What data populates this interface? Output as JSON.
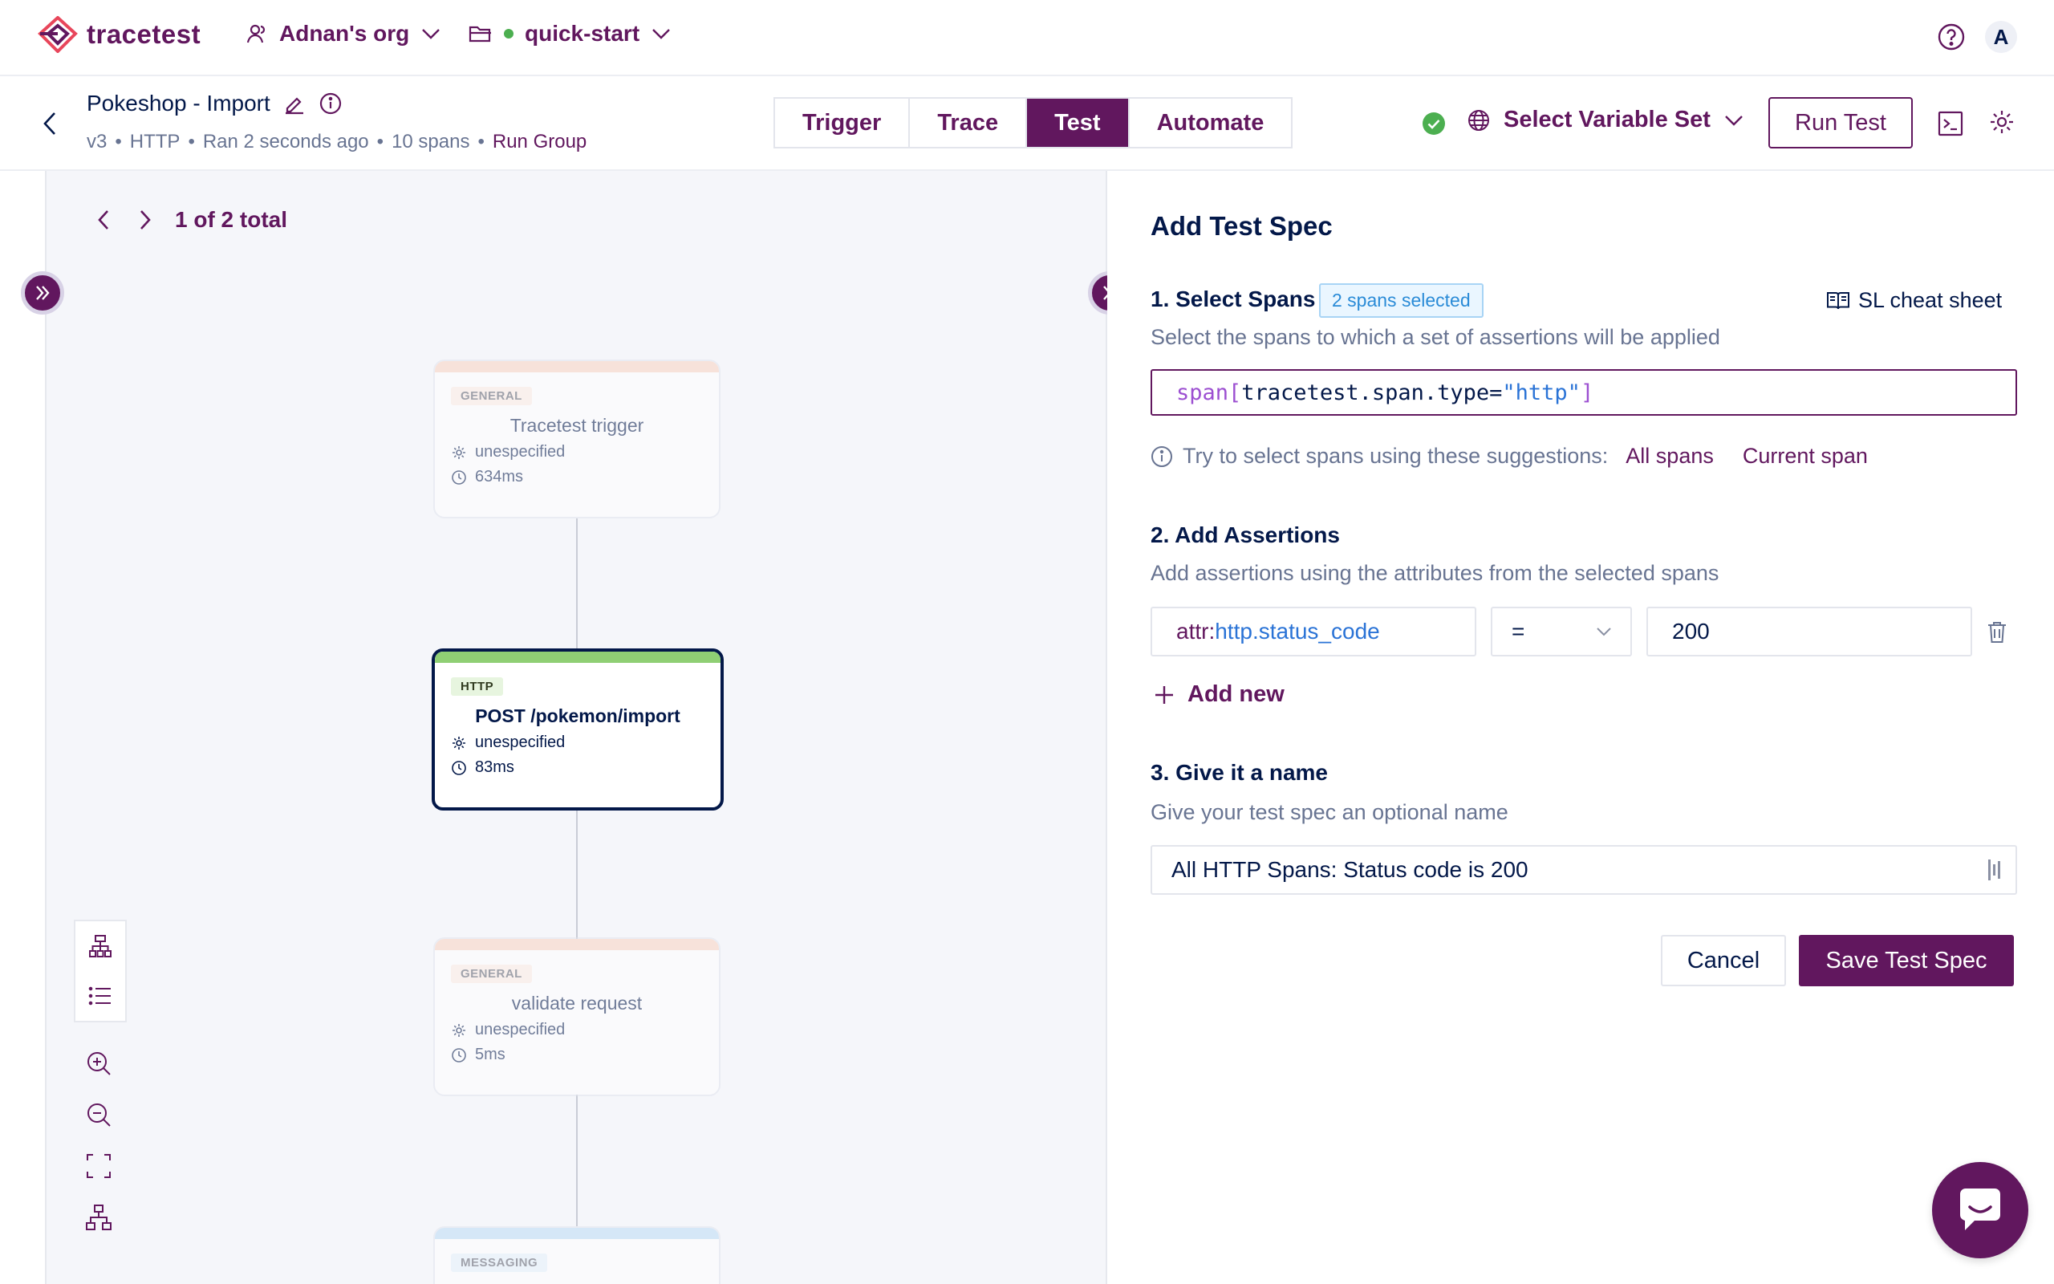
{
  "app": {
    "name": "tracetest"
  },
  "org": {
    "name": "Adnan's org"
  },
  "environment": {
    "name": "quick-start"
  },
  "user": {
    "initial": "A"
  },
  "test": {
    "title": "Pokeshop - Import",
    "meta": {
      "version": "v3",
      "trigger_type": "HTTP",
      "ran": "Ran 2 seconds ago",
      "spans": "10 spans",
      "run_group": "Run Group",
      "separator": "•"
    }
  },
  "tabs": [
    {
      "label": "Trigger",
      "active": false
    },
    {
      "label": "Trace",
      "active": false
    },
    {
      "label": "Test",
      "active": true
    },
    {
      "label": "Automate",
      "active": false
    }
  ],
  "toolbar": {
    "variable_set_label": "Select Variable Set",
    "run_label": "Run Test"
  },
  "pager": {
    "label": "1 of 2 total"
  },
  "nodes": [
    {
      "kind": "GENERAL",
      "name": "Tracetest trigger",
      "service": "unespecified",
      "duration": "634ms"
    },
    {
      "kind": "HTTP",
      "name": "POST /pokemon/import",
      "service": "unespecified",
      "duration": "83ms"
    },
    {
      "kind": "GENERAL",
      "name": "validate request",
      "service": "unespecified",
      "duration": "5ms"
    },
    {
      "kind": "MESSAGING"
    }
  ],
  "spec": {
    "title": "Add Test Spec",
    "select": {
      "heading": "1. Select Spans",
      "chip": "2 spans selected",
      "cheat_sheet": "SL cheat sheet",
      "subtitle": "Select the spans to which a set of assertions will be applied",
      "selector": {
        "kw": "span[",
        "attr": "tracetest.span.type=",
        "str": "\"http\"",
        "close": "]"
      },
      "suggest_text": "Try to select spans using these suggestions:",
      "suggestions": [
        "All spans",
        "Current span"
      ]
    },
    "assert": {
      "heading": "2. Add Assertions",
      "subtitle": "Add assertions using the attributes from the selected spans",
      "attr_prefix": "attr:",
      "attr_name": "http.status_code",
      "operator": "=",
      "value": "200",
      "add_new": "Add new"
    },
    "name": {
      "heading": "3. Give it a name",
      "subtitle": "Give your test spec an optional name",
      "value": "All HTTP Spans: Status  code is 200"
    },
    "cancel_label": "Cancel",
    "save_label": "Save Test Spec"
  },
  "colors": {
    "brand": "#61175e",
    "text": "#031849",
    "http_bar": "#8fcf74",
    "general_bar": "#f9d3c0",
    "messaging_bar": "#bcdcf5",
    "success": "#4caf50"
  }
}
